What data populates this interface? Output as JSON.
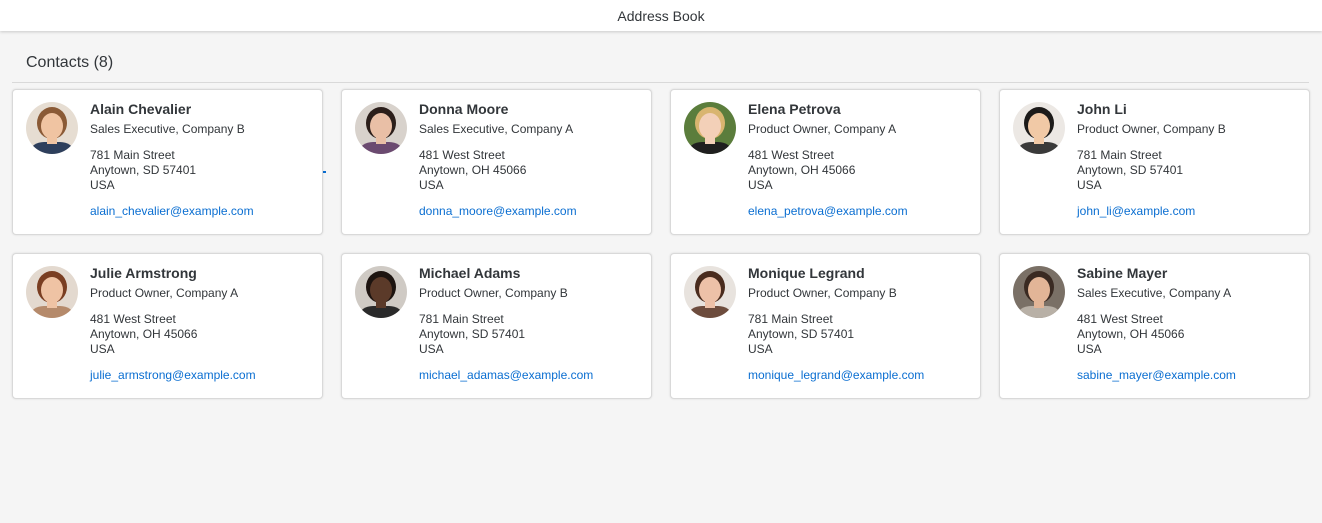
{
  "header": {
    "title": "Address Book"
  },
  "contacts_title": "Contacts (8)",
  "colors": {
    "link": "#0a6ed1",
    "text": "#32363a",
    "background": "#f5f5f5",
    "card": "#ffffff"
  },
  "contacts": [
    {
      "name": "Alain Chevalier",
      "role": "Sales Executive, Company B",
      "street": "781 Main Street",
      "city": "Anytown, SD 57401",
      "country": "USA",
      "email": "alain_chevalier@example.com",
      "avatar": {
        "icon": "person-photo-icon",
        "bg": "#e6ddd2",
        "skin": "#f0c4a2",
        "hair": "#8a5a36",
        "shirt": "#2e3f5c"
      }
    },
    {
      "name": "Donna Moore",
      "role": "Sales Executive, Company A",
      "street": "481 West Street",
      "city": "Anytown, OH 45066",
      "country": "USA",
      "email": "donna_moore@example.com",
      "avatar": {
        "icon": "person-photo-icon",
        "bg": "#d8d2cc",
        "skin": "#e9bfa6",
        "hair": "#2b1e1a",
        "shirt": "#6b4a70"
      }
    },
    {
      "name": "Elena Petrova",
      "role": "Product Owner, Company A",
      "street": "481 West Street",
      "city": "Anytown, OH 45066",
      "country": "USA",
      "email": "elena_petrova@example.com",
      "avatar": {
        "icon": "person-photo-icon",
        "bg": "#5b7d3c",
        "skin": "#f3d0b8",
        "hair": "#d9b56f",
        "shirt": "#1f1f1f"
      }
    },
    {
      "name": "John Li",
      "role": "Product Owner, Company B",
      "street": "781 Main Street",
      "city": "Anytown, SD 57401",
      "country": "USA",
      "email": "john_li@example.com",
      "avatar": {
        "icon": "person-photo-icon",
        "bg": "#ece8e4",
        "skin": "#f1c9a6",
        "hair": "#1c1a19",
        "shirt": "#3a3a3a"
      }
    },
    {
      "name": "Julie Armstrong",
      "role": "Product Owner, Company A",
      "street": "481 West Street",
      "city": "Anytown, OH 45066",
      "country": "USA",
      "email": "julie_armstrong@example.com",
      "avatar": {
        "icon": "person-photo-icon",
        "bg": "#e3d9cf",
        "skin": "#efc3a4",
        "hair": "#7a3e22",
        "shirt": "#b58a6b"
      }
    },
    {
      "name": "Michael Adams",
      "role": "Product Owner, Company B",
      "street": "781 Main Street",
      "city": "Anytown, SD 57401",
      "country": "USA",
      "email": "michael_adamas@example.com",
      "avatar": {
        "icon": "person-photo-icon",
        "bg": "#cfcac4",
        "skin": "#5b3a29",
        "hair": "#1d1410",
        "shirt": "#2a2a2a"
      }
    },
    {
      "name": "Monique Legrand",
      "role": "Product Owner, Company B",
      "street": "781 Main Street",
      "city": "Anytown, SD 57401",
      "country": "USA",
      "email": "monique_legrand@example.com",
      "avatar": {
        "icon": "person-photo-icon",
        "bg": "#e8e3de",
        "skin": "#edc1a8",
        "hair": "#4a2c1e",
        "shirt": "#6d4c3d"
      }
    },
    {
      "name": "Sabine Mayer",
      "role": "Sales Executive, Company A",
      "street": "481 West Street",
      "city": "Anytown, OH 45066",
      "country": "USA",
      "email": "sabine_mayer@example.com",
      "avatar": {
        "icon": "person-photo-icon",
        "bg": "#7a7066",
        "skin": "#e2b597",
        "hair": "#3a2a22",
        "shirt": "#b8b0a6"
      }
    }
  ]
}
